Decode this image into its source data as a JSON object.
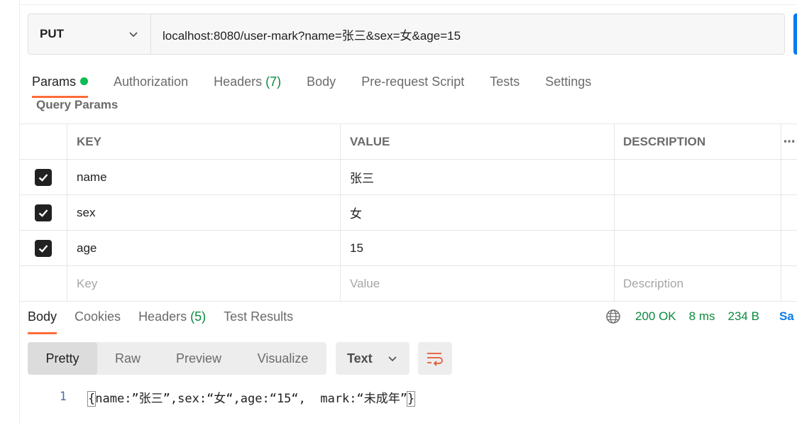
{
  "request": {
    "method": "PUT",
    "url": "localhost:8080/user-mark?name=张三&sex=女&age=15"
  },
  "request_tabs": {
    "params": "Params",
    "authorization": "Authorization",
    "headers": "Headers",
    "headers_count": "(7)",
    "body": "Body",
    "prerequest": "Pre-request Script",
    "tests": "Tests",
    "settings": "Settings"
  },
  "query_params": {
    "title": "Query Params",
    "columns": {
      "key": "KEY",
      "value": "VALUE",
      "description": "DESCRIPTION"
    },
    "rows": [
      {
        "checked": true,
        "key": "name",
        "value": "张三",
        "description": ""
      },
      {
        "checked": true,
        "key": "sex",
        "value": "女",
        "description": ""
      },
      {
        "checked": true,
        "key": "age",
        "value": "15",
        "description": ""
      }
    ],
    "placeholders": {
      "key": "Key",
      "value": "Value",
      "description": "Description"
    }
  },
  "response_tabs": {
    "body": "Body",
    "cookies": "Cookies",
    "headers": "Headers",
    "headers_count": "(5)",
    "test_results": "Test Results"
  },
  "response_status": {
    "status": "200 OK",
    "time": "8 ms",
    "size": "234 B",
    "save": "Sa"
  },
  "view_modes": {
    "pretty": "Pretty",
    "raw": "Raw",
    "preview": "Preview",
    "visualize": "Visualize"
  },
  "format": "Text",
  "response_body": {
    "line_number": "1",
    "open_brace": "{",
    "content": "name:”张三”,sex:“女“,age:“15“,  mark:“未成年”",
    "close_brace": "}"
  },
  "colors": {
    "accent": "#ff6c37",
    "success": "#0a8a3e",
    "dot": "#0cbb52",
    "link": "#097bed"
  }
}
